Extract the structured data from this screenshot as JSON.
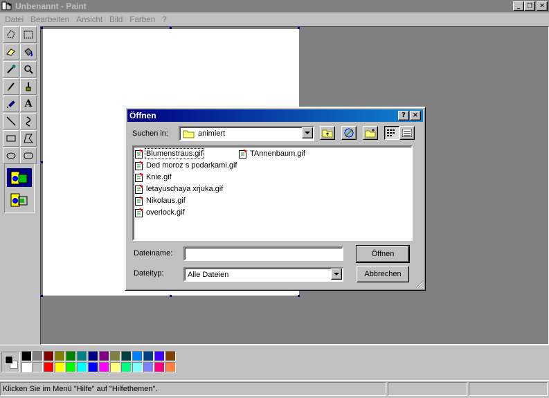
{
  "app": {
    "title": "Unbenannt - Paint",
    "window_controls": [
      "minimize-icon",
      "restore-icon",
      "close-icon"
    ]
  },
  "menubar": {
    "items": [
      "Datei",
      "Bearbeiten",
      "Ansicht",
      "Bild",
      "Farben",
      "?"
    ]
  },
  "toolbox": {
    "tools": [
      "free-select-icon",
      "rect-select-icon",
      "eraser-icon",
      "fill-bucket-icon",
      "color-picker-icon",
      "magnifier-icon",
      "pencil-icon",
      "brush-icon",
      "airbrush-icon",
      "text-icon",
      "line-icon",
      "curve-icon",
      "rectangle-icon",
      "polygon-icon",
      "ellipse-icon",
      "rounded-rect-icon"
    ],
    "options": [
      "opaque-option-icon",
      "transparent-option-icon"
    ]
  },
  "palette": {
    "colors_top": [
      "#000000",
      "#808080",
      "#800000",
      "#808000",
      "#008000",
      "#008080",
      "#000080",
      "#800080",
      "#808040",
      "#004040",
      "#0080ff",
      "#004080",
      "#4000ff",
      "#804000"
    ],
    "colors_bottom": [
      "#ffffff",
      "#c0c0c0",
      "#ff0000",
      "#ffff00",
      "#00ff00",
      "#00ffff",
      "#0000ff",
      "#ff00ff",
      "#ffff80",
      "#00ff80",
      "#80ffff",
      "#8080ff",
      "#ff0080",
      "#ff8040"
    ],
    "foreground": "#000000",
    "background": "#ffffff"
  },
  "status": {
    "text": "Klicken Sie im Menü \"Hilfe\" auf \"Hilfethemen\"."
  },
  "dialog": {
    "title": "Öffnen",
    "help_btn": "?",
    "close_btn": "×",
    "lookin_label": "Suchen in:",
    "lookin_value": "animiert",
    "toolbar": [
      "up-folder-icon",
      "desktop-icon",
      "new-folder-icon",
      "list-view-icon",
      "details-view-icon"
    ],
    "files": [
      "Blumenstraus.gif",
      "Ded moroz s podarkami.gif",
      "Knie.gif",
      "letayuschaya xrjuka.gif",
      "Nikolaus.gif",
      "overlock.gif",
      "TAnnenbaum.gif"
    ],
    "selected_file": "Blumenstraus.gif",
    "filename_label": "Dateiname:",
    "filename_value": "",
    "filetype_label": "Dateityp:",
    "filetype_value": "Alle Dateien",
    "open_button": "Öffnen",
    "cancel_button": "Abbrechen"
  }
}
